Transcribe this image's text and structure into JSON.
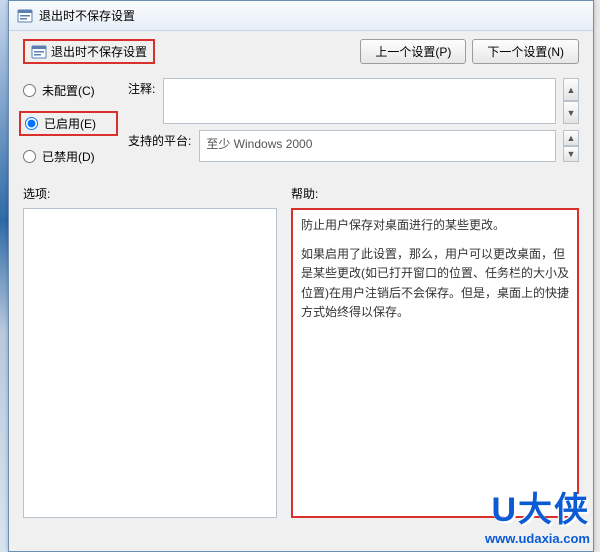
{
  "titlebar": {
    "title": "退出时不保存设置"
  },
  "header": {
    "policy_title": "退出时不保存设置",
    "prev_btn": "上一个设置(P)",
    "next_btn": "下一个设置(N)"
  },
  "radios": {
    "not_configured": "未配置(C)",
    "enabled": "已启用(E)",
    "disabled": "已禁用(D)",
    "selected": "enabled"
  },
  "labels": {
    "comment": "注释:",
    "supported": "支持的平台:",
    "options": "选项:",
    "help": "帮助:"
  },
  "fields": {
    "comment": "",
    "supported": "至少 Windows 2000"
  },
  "help": {
    "p1": "防止用户保存对桌面进行的某些更改。",
    "p2": "如果启用了此设置，那么，用户可以更改桌面，但是某些更改(如已打开窗口的位置、任务栏的大小及位置)在用户注销后不会保存。但是，桌面上的快捷方式始终得以保存。"
  },
  "watermark": {
    "logo": "U大侠",
    "url": "www.udaxia.com"
  }
}
